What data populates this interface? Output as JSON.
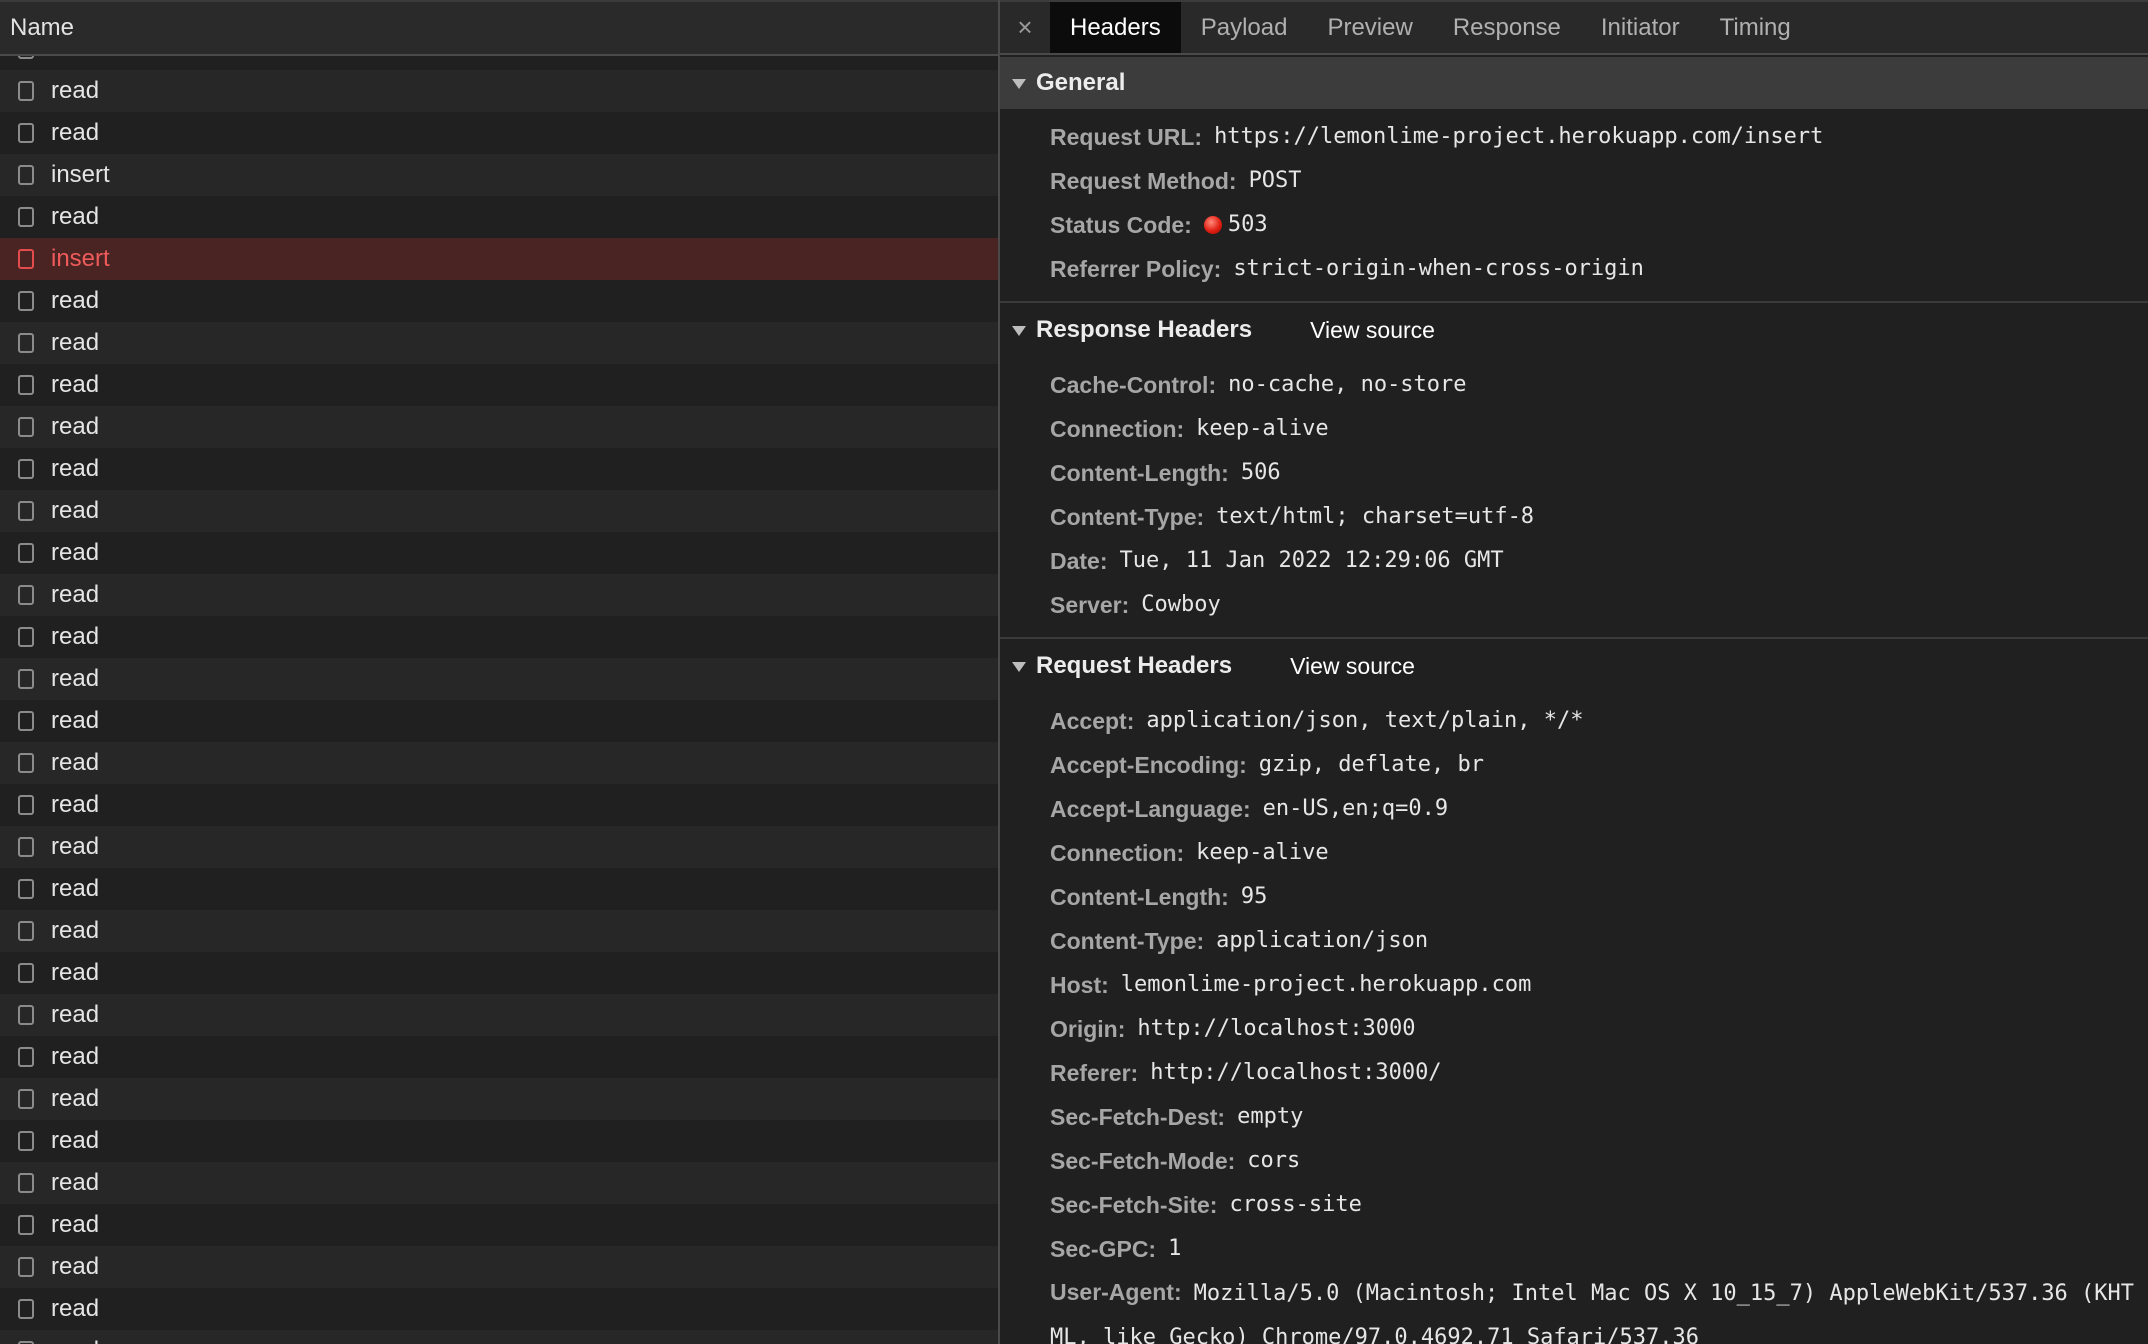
{
  "left_pane": {
    "column_header": "Name",
    "rows": [
      {
        "name": "read",
        "status": "normal"
      },
      {
        "name": "read",
        "status": "normal"
      },
      {
        "name": "read",
        "status": "normal"
      },
      {
        "name": "insert",
        "status": "normal"
      },
      {
        "name": "read",
        "status": "normal"
      },
      {
        "name": "insert",
        "status": "error"
      },
      {
        "name": "read",
        "status": "normal"
      },
      {
        "name": "read",
        "status": "normal"
      },
      {
        "name": "read",
        "status": "normal"
      },
      {
        "name": "read",
        "status": "normal"
      },
      {
        "name": "read",
        "status": "normal"
      },
      {
        "name": "read",
        "status": "normal"
      },
      {
        "name": "read",
        "status": "normal"
      },
      {
        "name": "read",
        "status": "normal"
      },
      {
        "name": "read",
        "status": "normal"
      },
      {
        "name": "read",
        "status": "normal"
      },
      {
        "name": "read",
        "status": "normal"
      },
      {
        "name": "read",
        "status": "normal"
      },
      {
        "name": "read",
        "status": "normal"
      },
      {
        "name": "read",
        "status": "normal"
      },
      {
        "name": "read",
        "status": "normal"
      },
      {
        "name": "read",
        "status": "normal"
      },
      {
        "name": "read",
        "status": "normal"
      },
      {
        "name": "read",
        "status": "normal"
      },
      {
        "name": "read",
        "status": "normal"
      },
      {
        "name": "read",
        "status": "normal"
      },
      {
        "name": "read",
        "status": "normal"
      },
      {
        "name": "read",
        "status": "normal"
      },
      {
        "name": "read",
        "status": "normal"
      },
      {
        "name": "read",
        "status": "normal"
      },
      {
        "name": "read",
        "status": "normal"
      },
      {
        "name": "read",
        "status": "normal"
      }
    ]
  },
  "tabs": {
    "close_glyph": "×",
    "items": [
      "Headers",
      "Payload",
      "Preview",
      "Response",
      "Initiator",
      "Timing"
    ],
    "active": "Headers"
  },
  "general": {
    "title": "General",
    "fields": [
      {
        "key": "Request URL:",
        "value": "https://lemonlime-project.herokuapp.com/insert"
      },
      {
        "key": "Request Method:",
        "value": "POST"
      },
      {
        "key": "Status Code:",
        "value": "503",
        "status_color": "#e01f12"
      },
      {
        "key": "Referrer Policy:",
        "value": "strict-origin-when-cross-origin"
      }
    ]
  },
  "response_headers": {
    "title": "Response Headers",
    "view_source": "View source",
    "fields": [
      {
        "key": "Cache-Control:",
        "value": "no-cache, no-store"
      },
      {
        "key": "Connection:",
        "value": "keep-alive"
      },
      {
        "key": "Content-Length:",
        "value": "506"
      },
      {
        "key": "Content-Type:",
        "value": "text/html; charset=utf-8"
      },
      {
        "key": "Date:",
        "value": "Tue, 11 Jan 2022 12:29:06 GMT"
      },
      {
        "key": "Server:",
        "value": "Cowboy"
      }
    ]
  },
  "request_headers": {
    "title": "Request Headers",
    "view_source": "View source",
    "fields": [
      {
        "key": "Accept:",
        "value": "application/json, text/plain, */*"
      },
      {
        "key": "Accept-Encoding:",
        "value": "gzip, deflate, br"
      },
      {
        "key": "Accept-Language:",
        "value": "en-US,en;q=0.9"
      },
      {
        "key": "Connection:",
        "value": "keep-alive"
      },
      {
        "key": "Content-Length:",
        "value": "95"
      },
      {
        "key": "Content-Type:",
        "value": "application/json"
      },
      {
        "key": "Host:",
        "value": "lemonlime-project.herokuapp.com"
      },
      {
        "key": "Origin:",
        "value": "http://localhost:3000"
      },
      {
        "key": "Referer:",
        "value": "http://localhost:3000/"
      },
      {
        "key": "Sec-Fetch-Dest:",
        "value": "empty"
      },
      {
        "key": "Sec-Fetch-Mode:",
        "value": "cors"
      },
      {
        "key": "Sec-Fetch-Site:",
        "value": "cross-site"
      },
      {
        "key": "Sec-GPC:",
        "value": "1"
      },
      {
        "key": "User-Agent:",
        "value": "Mozilla/5.0 (Macintosh; Intel Mac OS X 10_15_7) AppleWebKit/537.36 (KHTML, like Gecko) Chrome/97.0.4692.71 Safari/537.36"
      }
    ]
  },
  "colors": {
    "error_text": "#ef5b5b",
    "error_row_bg": "#4a2323",
    "active_tab_bg": "#0c0c0c"
  }
}
